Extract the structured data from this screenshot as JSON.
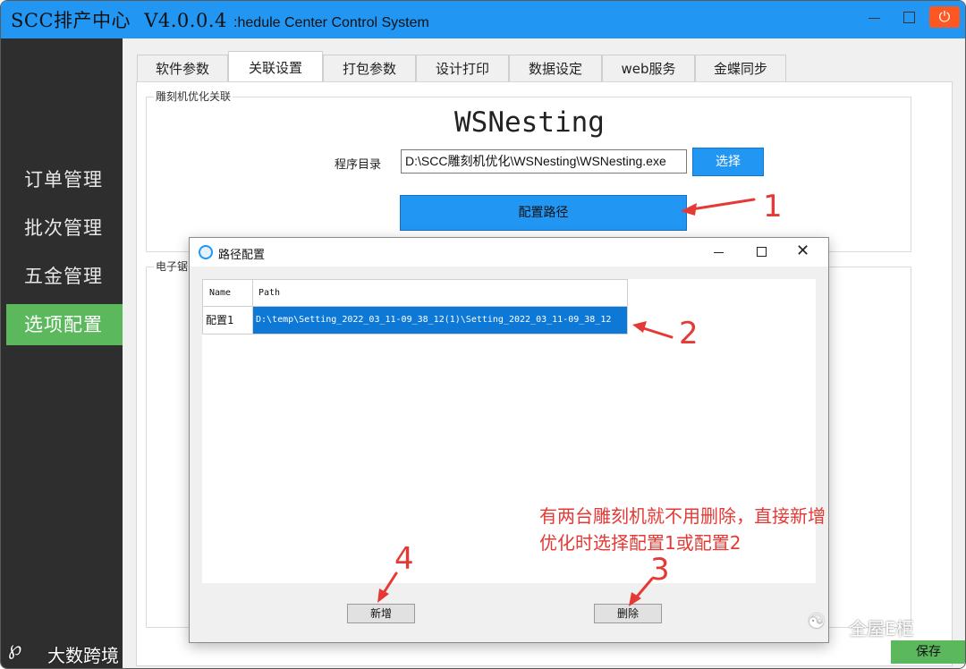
{
  "window": {
    "app_title": "SCC排产中心",
    "version": "V4.0.0.4",
    "subtitle": ":hedule Center Control System",
    "power_icon": "power-icon"
  },
  "sidebar": {
    "items": [
      {
        "label": "订单管理"
      },
      {
        "label": "批次管理"
      },
      {
        "label": "五金管理"
      },
      {
        "label": "选项配置",
        "active": true
      }
    ]
  },
  "tabs": [
    {
      "label": "软件参数"
    },
    {
      "label": "关联设置",
      "active": true
    },
    {
      "label": "打包参数"
    },
    {
      "label": "设计打印"
    },
    {
      "label": "数据设定"
    },
    {
      "label": "web服务"
    },
    {
      "label": "金蝶同步"
    }
  ],
  "engraver_group": {
    "title": "雕刻机优化关联",
    "program_title": "WSNesting",
    "dir_label": "程序目录",
    "dir_value": "D:\\SCC雕刻机优化\\WSNesting\\WSNesting.exe",
    "choose_label": "选择",
    "config_path_label": "配置路径"
  },
  "saw_group": {
    "title_partial": "电子锯"
  },
  "save_label": "保存",
  "dialog": {
    "title": "路径配置",
    "columns": [
      "Name",
      "Path"
    ],
    "rows": [
      {
        "name": "配置1",
        "path": "D:\\temp\\Setting_2022_03_11-09_38_12(1)\\Setting_2022_03_11-09_38_12"
      }
    ],
    "add_label": "新增",
    "delete_label": "删除"
  },
  "annotations": {
    "n1": "1",
    "n2": "2",
    "n3": "3",
    "n4": "4",
    "note_line1": "有两台雕刻机就不用删除，直接新增",
    "note_line2": "优化时选择配置1或配置2",
    "color": "#e53935"
  },
  "watermarks": {
    "left": "大数跨境",
    "right": "全屋E柜"
  },
  "colors": {
    "titlebar": "#2196f3",
    "sidebar": "#2e2e2e",
    "active_green": "#5cb85c",
    "accent_blue": "#2196f3",
    "power": "#ff5722",
    "selection": "#0e78d7"
  }
}
